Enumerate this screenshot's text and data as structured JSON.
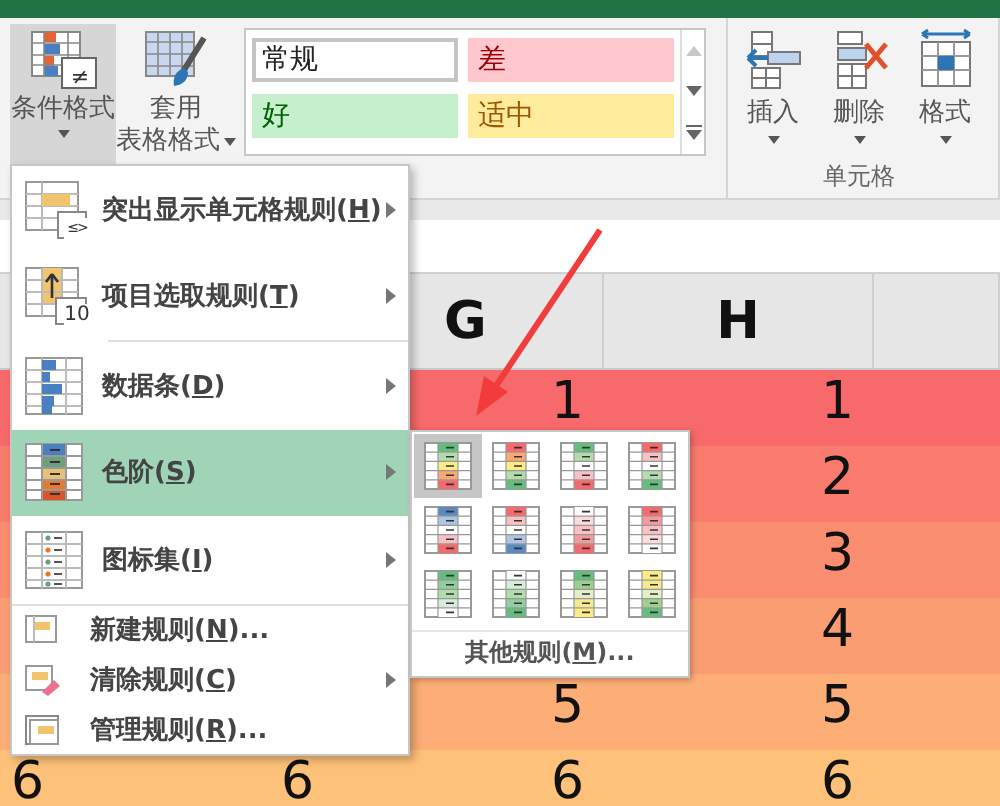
{
  "ribbon": {
    "conditional_format": {
      "label": "条件格式",
      "badge": "≠",
      "selected": true
    },
    "table_format": {
      "lines": [
        "套用",
        "表格格式"
      ]
    },
    "styles": [
      {
        "label": "常规",
        "kind": "normal",
        "selected": true
      },
      {
        "label": "差",
        "kind": "bad",
        "selected": false
      },
      {
        "label": "好",
        "kind": "good",
        "selected": false
      },
      {
        "label": "适中",
        "kind": "neutral",
        "selected": false
      }
    ],
    "cell_buttons": [
      {
        "label": "插入"
      },
      {
        "label": "删除"
      },
      {
        "label": "格式"
      }
    ],
    "cells_group_label": "单元格"
  },
  "sheet": {
    "columns": [
      "G",
      "H"
    ],
    "rows": [
      {
        "color": "#f8696b",
        "g": "1",
        "h": "1"
      },
      {
        "color": "#f97b6d",
        "h": "2"
      },
      {
        "color": "#fa8c70",
        "h": "3"
      },
      {
        "color": "#fb9d73",
        "h": "4"
      },
      {
        "color": "#fcae76",
        "g": "5",
        "h": "5"
      },
      {
        "color": "#fdc17a",
        "left_cells": [
          "6",
          "6"
        ],
        "g": "6",
        "h": "6"
      }
    ]
  },
  "menu": {
    "items": [
      {
        "badge": "≤>",
        "prefix": "突出显示单元格规则(",
        "key": "H",
        "suffix": ")",
        "submenu": true,
        "selected": false,
        "divider_after": false
      },
      {
        "badge": "10",
        "prefix": "项目选取规则(",
        "key": "T",
        "suffix": ")",
        "submenu": true,
        "selected": false,
        "divider_after": true
      },
      {
        "prefix": "数据条(",
        "key": "D",
        "suffix": ")",
        "submenu": true,
        "selected": false,
        "divider_after": false
      },
      {
        "prefix": "色阶(",
        "key": "S",
        "suffix": ")",
        "submenu": true,
        "selected": true,
        "divider_after": false
      },
      {
        "prefix": "图标集(",
        "key": "I",
        "suffix": ")",
        "submenu": true,
        "selected": false,
        "divider_after": true
      },
      {
        "prefix": "新建规则(",
        "key": "N",
        "suffix": ")...",
        "submenu": false,
        "selected": false,
        "divider_after": false
      },
      {
        "prefix": "清除规则(",
        "key": "C",
        "suffix": ")",
        "submenu": true,
        "selected": false,
        "divider_after": false
      },
      {
        "prefix": "管理规则(",
        "key": "R",
        "suffix": ")...",
        "submenu": false,
        "selected": false,
        "divider_after": false
      }
    ]
  },
  "submenu": {
    "swatches": [
      {
        "selected": true
      },
      {
        "selected": false
      },
      {
        "selected": false
      },
      {
        "selected": false
      },
      {
        "selected": false
      },
      {
        "selected": false
      },
      {
        "selected": false
      },
      {
        "selected": false
      },
      {
        "selected": false
      },
      {
        "selected": false
      },
      {
        "selected": false
      },
      {
        "selected": false
      }
    ],
    "more": {
      "prefix": "其他规则(",
      "key": "M",
      "suffix": ")..."
    }
  }
}
